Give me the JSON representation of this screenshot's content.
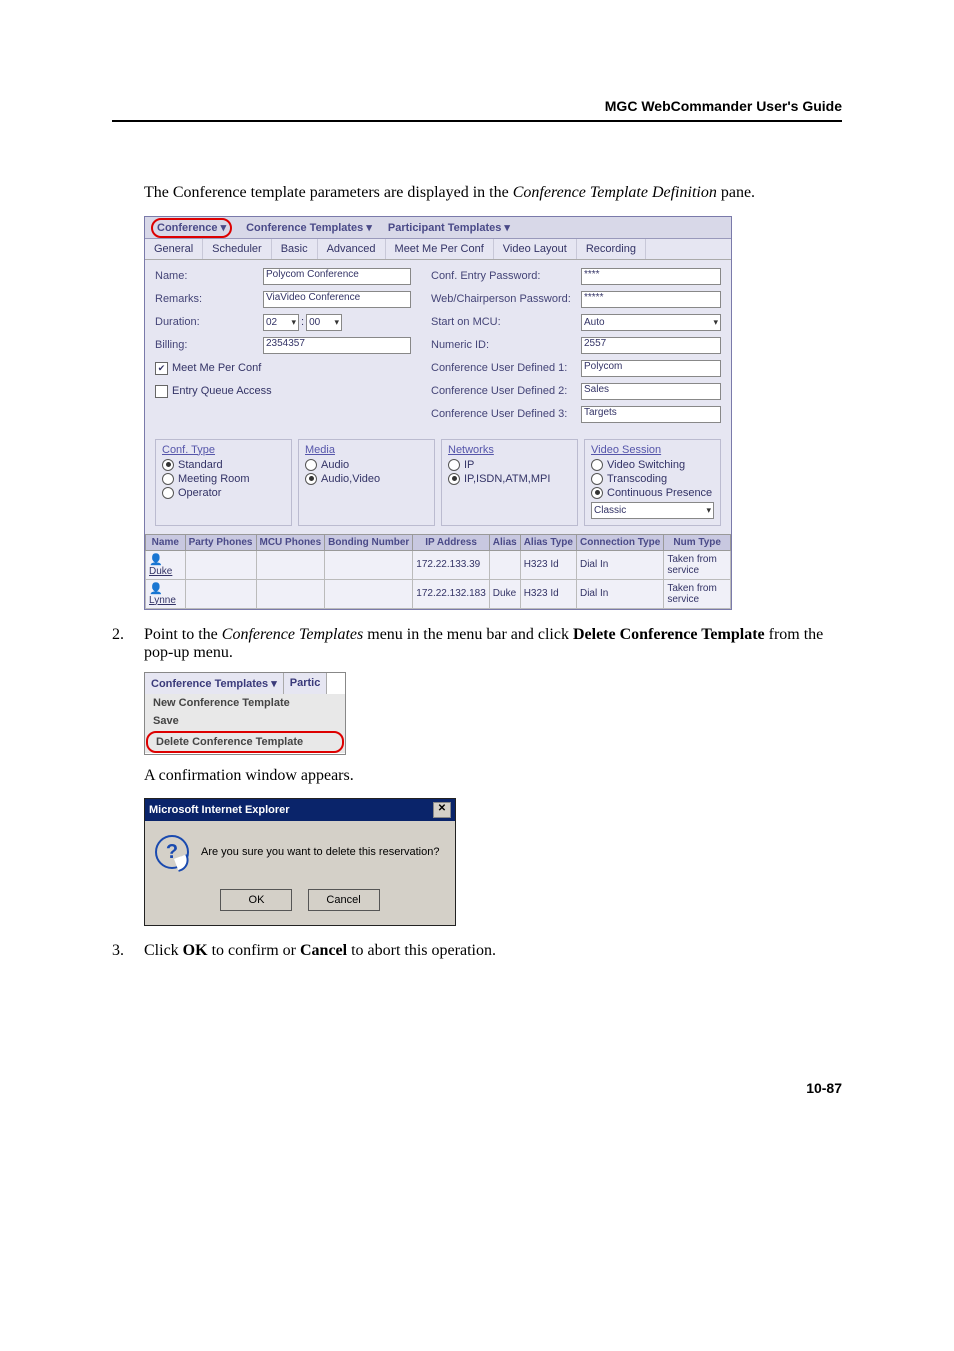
{
  "header": {
    "title": "MGC WebCommander User's Guide"
  },
  "intro": {
    "line1": "The Conference template parameters are displayed in the ",
    "line1_it": "Conference Template Definition",
    "line1_end": " pane."
  },
  "sc": {
    "menubar": {
      "conference": "Conference",
      "conf_templates": "Conference Templates",
      "part_templates": "Participant Templates"
    },
    "tabs": [
      "General",
      "Scheduler",
      "Basic",
      "Advanced",
      "Meet Me Per Conf",
      "Video Layout",
      "Recording"
    ],
    "labels": {
      "name": "Name:",
      "remarks": "Remarks:",
      "duration": "Duration:",
      "billing": "Billing:",
      "meet_me": "Meet Me Per Conf",
      "entry_q": "Entry Queue Access",
      "entry_pw": "Conf. Entry Password:",
      "chair_pw": "Web/Chairperson Password:",
      "start_mcu": "Start on MCU:",
      "numeric": "Numeric ID:",
      "ud1": "Conference User Defined 1:",
      "ud2": "Conference User Defined 2:",
      "ud3": "Conference User Defined 3:"
    },
    "values": {
      "name": "Polycom Conference",
      "remarks": "ViaVideo Conference",
      "dur_h": "02",
      "dur_m": "00",
      "billing": "2354357",
      "entry_pw": "****",
      "chair_pw": "*****",
      "start_mcu": "Auto",
      "numeric": "2557",
      "ud1": "Polycom",
      "ud2": "Sales",
      "ud3": "Targets"
    },
    "groups": {
      "conf_type": {
        "title": "Conf. Type",
        "opts": [
          "Standard",
          "Meeting Room",
          "Operator"
        ],
        "sel": 0
      },
      "media": {
        "title": "Media",
        "opts": [
          "Audio",
          "Audio,Video"
        ],
        "sel": 1
      },
      "networks": {
        "title": "Networks",
        "opts": [
          "IP",
          "IP,ISDN,ATM,MPI"
        ],
        "sel": 1
      },
      "video": {
        "title": "Video Session",
        "opts": [
          "Video Switching",
          "Transcoding",
          "Continuous Presence"
        ],
        "sel": 2,
        "extra": "Classic"
      }
    },
    "table": {
      "headers": [
        "Name",
        "Party Phones",
        "MCU Phones",
        "Bonding Number",
        "IP Address",
        "Alias",
        "Alias Type",
        "Connection Type",
        "Num Type"
      ],
      "rows": [
        {
          "name": "Duke",
          "ip": "172.22.133.39",
          "alias": "",
          "alias_type": "H323 Id",
          "conn_type": "Dial In",
          "num_type": "Taken from service"
        },
        {
          "name": "Lynne",
          "ip": "172.22.132.183",
          "alias": "Duke",
          "alias_type": "H323 Id",
          "conn_type": "Dial In",
          "num_type": "Taken from service"
        }
      ]
    }
  },
  "step2": {
    "num": "2.",
    "a": "Point to the ",
    "a_it": "Conference Templates",
    "b": " menu in the menu bar and click ",
    "b_bold": "Delete Conference Template",
    "c": " from the pop-up menu."
  },
  "dd": {
    "head1": "Conference Templates",
    "head2": "Partic",
    "items": [
      "New Conference Template",
      "Save",
      "Delete Conference Template"
    ]
  },
  "confirm_text": "A confirmation window appears.",
  "dlg": {
    "title": "Microsoft Internet Explorer",
    "msg": "Are you sure you want to delete this reservation?",
    "ok": "OK",
    "cancel": "Cancel"
  },
  "step3": {
    "num": "3.",
    "a": "Click ",
    "ok": "OK",
    "b": " to confirm or ",
    "cancel": "Cancel",
    "c": " to abort this operation."
  },
  "footer": "10-87"
}
